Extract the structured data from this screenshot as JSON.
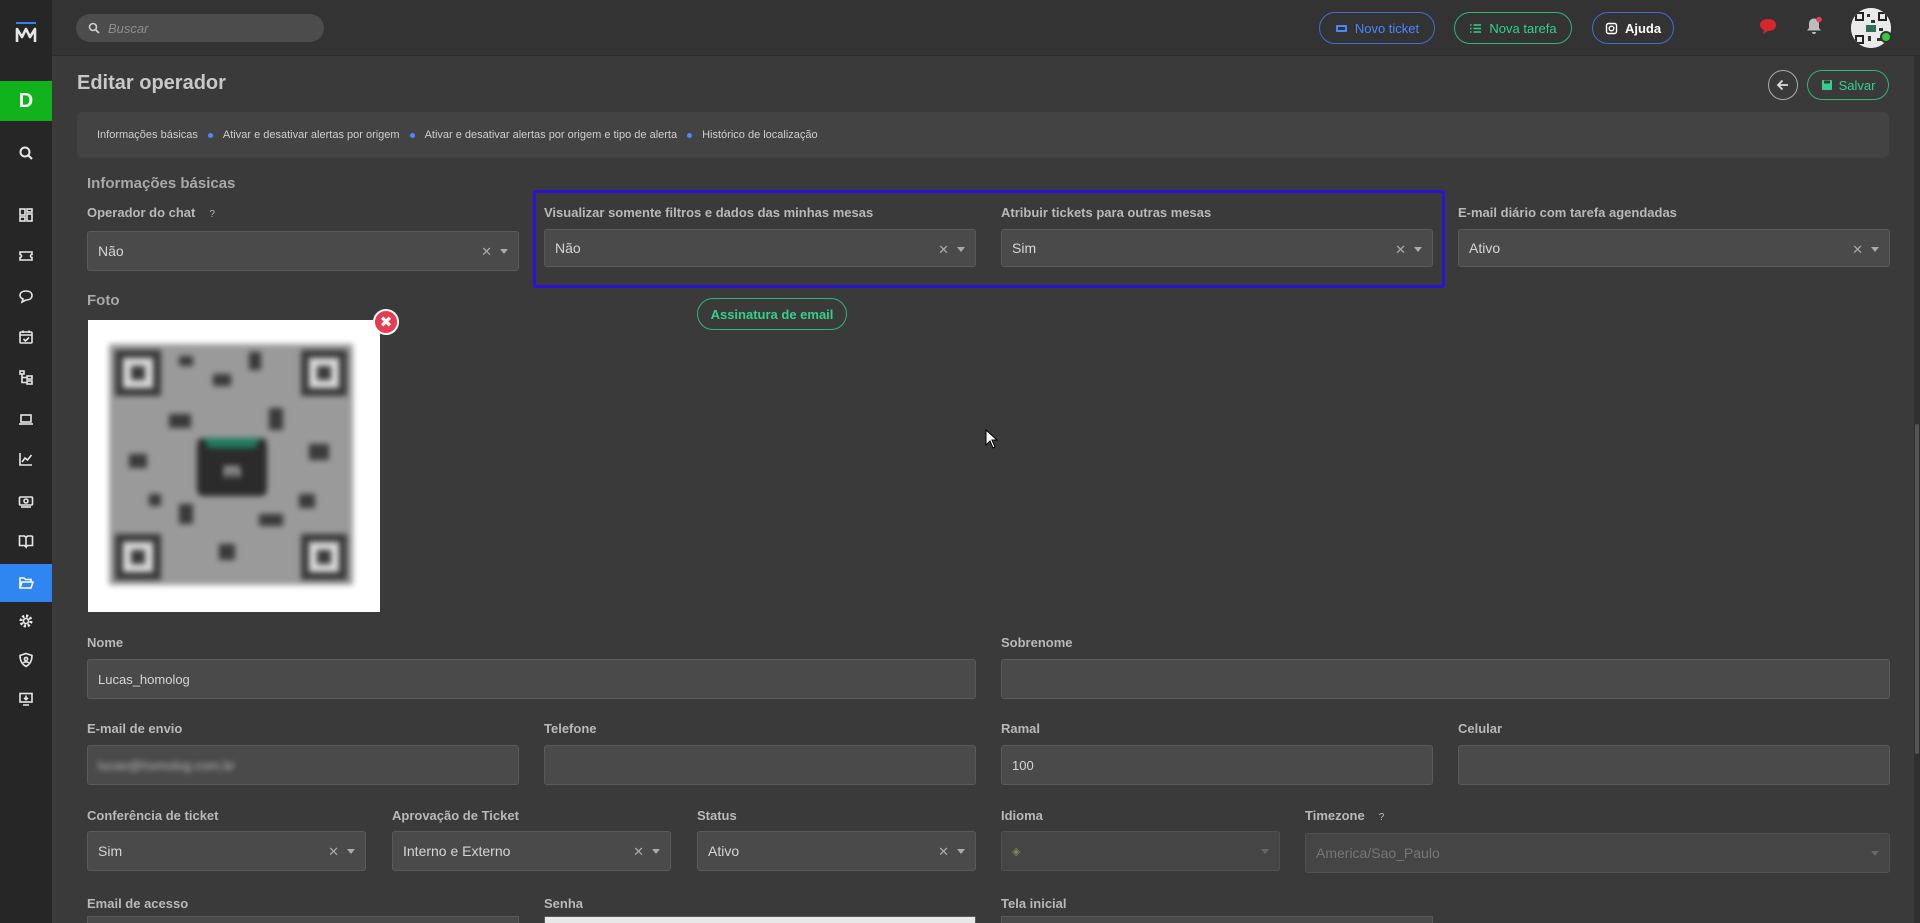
{
  "sidebar": {
    "workspace_initial": "D",
    "items": [
      {
        "name": "search"
      },
      {
        "name": "dashboard"
      },
      {
        "name": "tickets"
      },
      {
        "name": "chat"
      },
      {
        "name": "calendar"
      },
      {
        "name": "hierarchy"
      },
      {
        "name": "devices"
      },
      {
        "name": "reports"
      },
      {
        "name": "billing"
      },
      {
        "name": "knowledge-base"
      },
      {
        "name": "folders",
        "active": true
      },
      {
        "name": "settings"
      },
      {
        "name": "security"
      },
      {
        "name": "remote-access"
      }
    ]
  },
  "topbar": {
    "search_placeholder": "Buscar",
    "new_ticket_label": "Novo ticket",
    "new_task_label": "Nova tarefa",
    "help_label": "Ajuda"
  },
  "page": {
    "title": "Editar operador",
    "save_label": "Salvar"
  },
  "breadcrumb": {
    "items": [
      "Informações básicas",
      "Ativar e desativar alertas por origem",
      "Ativar e desativar alertas por origem e tipo de alerta",
      "Histórico de localização"
    ]
  },
  "form": {
    "section_title": "Informações básicas",
    "chat_operator": {
      "label": "Operador do chat",
      "help": "?",
      "value": "Não"
    },
    "view_own_tables": {
      "label": "Visualizar somente filtros e dados das minhas mesas",
      "value": "Não"
    },
    "assign_tickets": {
      "label": "Atribuir tickets para outras mesas",
      "value": "Sim"
    },
    "daily_email": {
      "label": "E-mail diário com tarefa agendadas",
      "value": "Ativo"
    },
    "signature_button": "Assinatura de email",
    "photo_label": "Foto",
    "photo_remove": "✖",
    "first_name": {
      "label": "Nome",
      "value": "Lucas_homolog"
    },
    "last_name": {
      "label": "Sobrenome",
      "value": ""
    },
    "send_email": {
      "label": "E-mail de envio",
      "value": "lucas@homolog.com.br"
    },
    "phone": {
      "label": "Telefone",
      "value": ""
    },
    "extension": {
      "label": "Ramal",
      "value": "100"
    },
    "mobile": {
      "label": "Celular",
      "value": ""
    },
    "ticket_check": {
      "label": "Conferência de ticket",
      "value": "Sim"
    },
    "ticket_approval": {
      "label": "Aprovação de Ticket",
      "value": "Interno e Externo"
    },
    "status": {
      "label": "Status",
      "value": "Ativo"
    },
    "language": {
      "label": "Idioma",
      "value": ""
    },
    "timezone": {
      "label": "Timezone",
      "help": "?",
      "value": "America/Sao_Paulo"
    },
    "access_email": {
      "label": "Email de acesso"
    },
    "password": {
      "label": "Senha"
    },
    "home_screen": {
      "label": "Tela inicial"
    }
  },
  "colors": {
    "accent_blue": "#2f86f0",
    "accent_green": "#35d08b",
    "highlight_border": "#2a12d6",
    "workspace_green": "#11b31d"
  }
}
